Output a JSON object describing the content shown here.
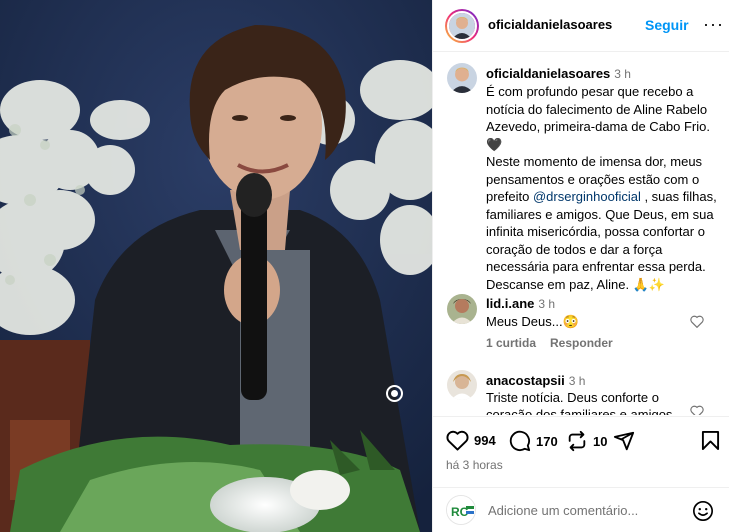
{
  "post": {
    "author": "oficialdanielasoares",
    "follow_label": "Seguir",
    "more_label": "···"
  },
  "caption": {
    "author": "oficialdanielasoares",
    "time": "3 h",
    "line1": "É com profundo pesar que recebo a notícia do falecimento de Aline Rabelo Azevedo, primeira-dama de Cabo Frio.",
    "heart_emoji": "🖤",
    "line2_pre": "Neste momento de imensa dor, meus pensamentos e orações estão com o prefeito ",
    "mention": "@drserginhooficial",
    "line2_post": " , suas filhas, familiares e amigos. Que Deus, em sua infinita misericórdia, possa confortar o coração de todos e dar a força necessária para enfrentar essa perda. Descanse em paz, Aline. 🙏✨"
  },
  "comments": [
    {
      "author": "lid.i.ane",
      "time": "3 h",
      "text": "Meus Deus...😳",
      "likes_label": "1 curtida",
      "reply_label": "Responder"
    },
    {
      "author": "anacostapsii",
      "time": "3 h",
      "text": "Triste notícia. Deus conforte o coração dos familiares e amigos."
    }
  ],
  "actions": {
    "likes": "994",
    "comments": "170",
    "reposts": "10",
    "posted": "há 3 horas"
  },
  "composer": {
    "placeholder": "Adicione um comentário...",
    "avatar_text": "RC"
  },
  "colors": {
    "accent": "#0095f6",
    "mention": "#00376b",
    "muted": "#737373"
  },
  "icons": [
    "heart-icon",
    "comment-icon",
    "repost-icon",
    "share-icon",
    "bookmark-icon",
    "emoji-icon",
    "sound-icon",
    "more-icon"
  ]
}
